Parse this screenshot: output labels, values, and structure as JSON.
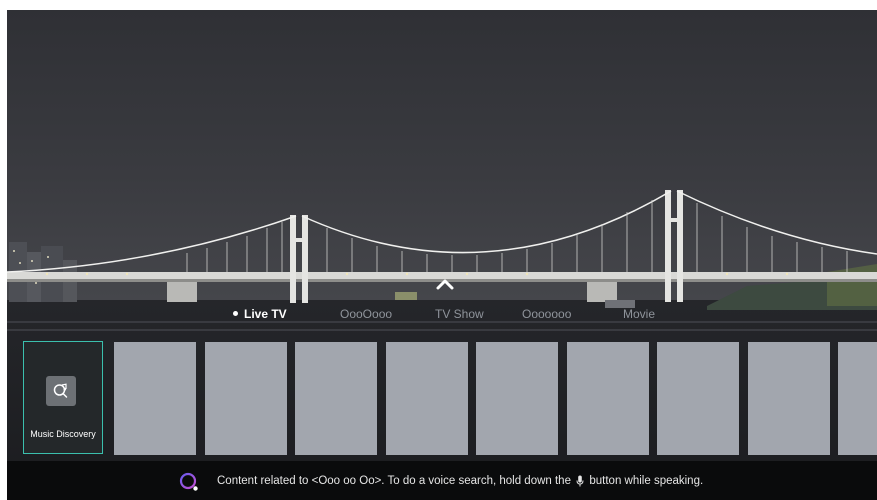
{
  "nav": {
    "tabs": [
      {
        "label": "Live TV",
        "active": true
      },
      {
        "label": "OooOooo",
        "active": false
      },
      {
        "label": "TV Show",
        "active": false
      },
      {
        "label": "Ooooooo",
        "active": false
      },
      {
        "label": "Movie",
        "active": false
      }
    ]
  },
  "cards": {
    "focused": {
      "label": "Music Discovery",
      "icon": "music-search-icon"
    },
    "placeholder_count": 9
  },
  "hint": {
    "before_mic": "Content related to <Ooo oo Oo>. To do a voice search, hold down the",
    "after_mic": "button while speaking.",
    "icons": [
      "voice-assistant-icon",
      "mic-icon"
    ]
  },
  "colors": {
    "focus_border": "#3bbfad",
    "card_placeholder": "#a2a6ae",
    "hint_bar": "#0a0b0c",
    "voice_ring": "#8a4bd6"
  }
}
